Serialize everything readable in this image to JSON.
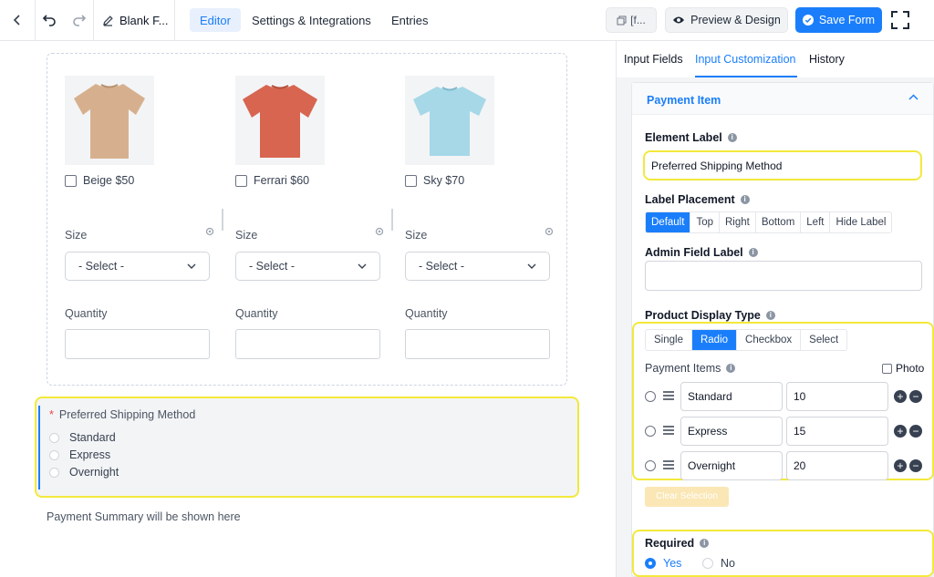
{
  "topbar": {
    "form_name": "Blank F...",
    "tabs": [
      "Editor",
      "Settings & Integrations",
      "Entries"
    ],
    "active_tab": "Editor",
    "shortcode_label": "[f...",
    "preview_label": "Preview & Design",
    "save_label": "Save Form"
  },
  "canvas": {
    "products": [
      {
        "label": "Beige $50",
        "shirt_color": "#d6b08e"
      },
      {
        "label": "Ferrari $60",
        "shirt_color": "#d76550"
      },
      {
        "label": "Sky $70",
        "shirt_color": "#a6d8e7"
      }
    ],
    "size_label": "Size",
    "select_placeholder": "- Select -",
    "quantity_label": "Quantity",
    "shipping": {
      "title": "Preferred Shipping Method",
      "required_mark": "*",
      "options": [
        "Standard",
        "Express",
        "Overnight"
      ]
    },
    "summary_text": "Payment Summary will be shown here"
  },
  "panel": {
    "tabs": [
      "Input Fields",
      "Input Customization",
      "History"
    ],
    "active_tab": "Input Customization",
    "section_title": "Payment Item",
    "element_label": {
      "label": "Element Label",
      "value": "Preferred Shipping Method"
    },
    "label_placement": {
      "label": "Label Placement",
      "options": [
        "Default",
        "Top",
        "Right",
        "Bottom",
        "Left",
        "Hide Label"
      ],
      "selected": "Default"
    },
    "admin_field_label": {
      "label": "Admin Field Label",
      "value": ""
    },
    "product_display_type": {
      "label": "Product Display Type",
      "options": [
        "Single",
        "Radio",
        "Checkbox",
        "Select"
      ],
      "selected": "Radio"
    },
    "payment_items": {
      "label": "Payment Items",
      "photo_label": "Photo",
      "items": [
        {
          "name": "Standard",
          "value": "10"
        },
        {
          "name": "Express",
          "value": "15"
        },
        {
          "name": "Overnight",
          "value": "20"
        }
      ]
    },
    "clear_selection": "Clear Selection",
    "required": {
      "label": "Required",
      "yes": "Yes",
      "no": "No",
      "selected": "Yes"
    }
  },
  "colors": {
    "accent": "#1a7efb",
    "highlight": "#f2e93c"
  }
}
